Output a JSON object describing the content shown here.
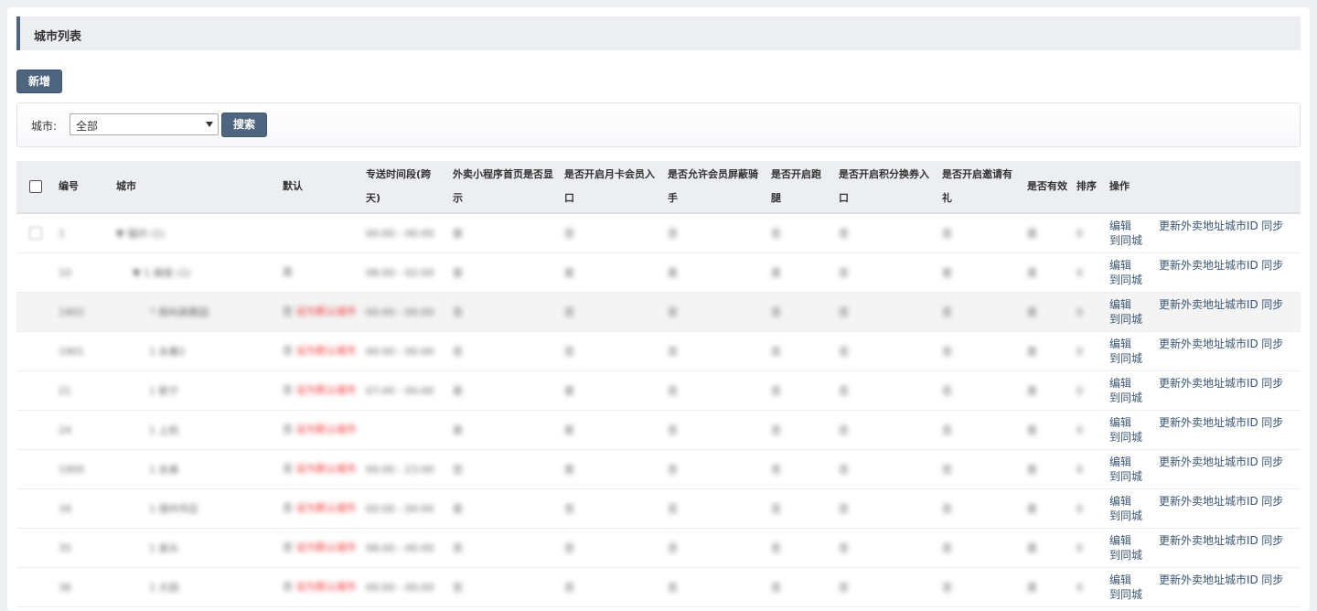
{
  "panel": {
    "title": "城市列表"
  },
  "toolbar": {
    "add_label": "新增"
  },
  "filter": {
    "city_label": "城市:",
    "city_value": "全部",
    "search_label": "搜索"
  },
  "table": {
    "headers": [
      "编号",
      "城市",
      "默认",
      "专送时间段(跨天)",
      "外卖小程序首页是否显示",
      "是否开启月卡会员入口",
      "是否允许会员屏蔽骑手",
      "是否开启跑腿",
      "是否开启积分换券入口",
      "是否开启邀请有礼",
      "是否有效",
      "排序",
      "操作"
    ],
    "actions": {
      "edit": "编辑",
      "update": "更新外卖地址城市ID",
      "sync": "同步",
      "to_city": "到同城"
    },
    "rows": [
      {
        "id": "1",
        "city": "▼ 福州 (1)",
        "def": "",
        "def_red": "",
        "time": "00:00 - 00:00",
        "f1": "是",
        "f2": "否",
        "f3": "否",
        "f4": "否",
        "f5": "否",
        "f6": "否",
        "valid": "是",
        "sort": "0"
      },
      {
        "id": "10",
        "city": "▼ 1 闽侯 (1)",
        "def": "是",
        "def_red": "",
        "time": "08:00 - 02:00",
        "f1": "是",
        "f2": "是",
        "f3": "是",
        "f4": "是",
        "f5": "否",
        "f6": "是",
        "valid": "是",
        "sort": "0"
      },
      {
        "id": "1902",
        "city": "└ 南屿高教园",
        "def": "否",
        "def_red": "设为默认城市",
        "time": "00:00 - 00:00",
        "f1": "否",
        "f2": "否",
        "f3": "否",
        "f4": "否",
        "f5": "否",
        "f6": "否",
        "valid": "是",
        "sort": "0"
      },
      {
        "id": "1901",
        "city": "1 永春2",
        "def": "否",
        "def_red": "设为默认城市",
        "time": "00:00 - 00:00",
        "f1": "否",
        "f2": "否",
        "f3": "否",
        "f4": "否",
        "f5": "否",
        "f6": "否",
        "valid": "是",
        "sort": "0"
      },
      {
        "id": "21",
        "city": "1 新宁",
        "def": "否",
        "def_red": "设为默认城市",
        "time": "07:00 - 00:00",
        "f1": "是",
        "f2": "是",
        "f3": "否",
        "f4": "否",
        "f5": "否",
        "f6": "否",
        "valid": "是",
        "sort": "0"
      },
      {
        "id": "24",
        "city": "1 上杭",
        "def": "否",
        "def_red": "设为默认城市",
        "time": "",
        "f1": "是",
        "f2": "是",
        "f3": "否",
        "f4": "否",
        "f5": "否",
        "f6": "否",
        "valid": "是",
        "sort": "0"
      },
      {
        "id": "1900",
        "city": "1 永泰",
        "def": "否",
        "def_red": "设为默认城市",
        "time": "00:00 - 23:00",
        "f1": "否",
        "f2": "是",
        "f3": "否",
        "f4": "否",
        "f5": "否",
        "f6": "否",
        "valid": "是",
        "sort": "0"
      },
      {
        "id": "34",
        "city": "1 德州市区",
        "def": "否",
        "def_red": "设为默认城市",
        "time": "00:00 - 00:00",
        "f1": "是",
        "f2": "否",
        "f3": "否",
        "f4": "否",
        "f5": "否",
        "f6": "否",
        "valid": "是",
        "sort": "0"
      },
      {
        "id": "35",
        "city": "1 泉头",
        "def": "否",
        "def_red": "设为默认城市",
        "time": "08:00 - 00:00",
        "f1": "否",
        "f2": "否",
        "f3": "否",
        "f4": "否",
        "f5": "否",
        "f6": "否",
        "valid": "是",
        "sort": "0"
      },
      {
        "id": "36",
        "city": "1 大田",
        "def": "否",
        "def_red": "设为默认城市",
        "time": "00:00 - 00:00",
        "f1": "否",
        "f2": "否",
        "f3": "否",
        "f4": "否",
        "f5": "否",
        "f6": "否",
        "valid": "是",
        "sort": "0"
      }
    ]
  }
}
